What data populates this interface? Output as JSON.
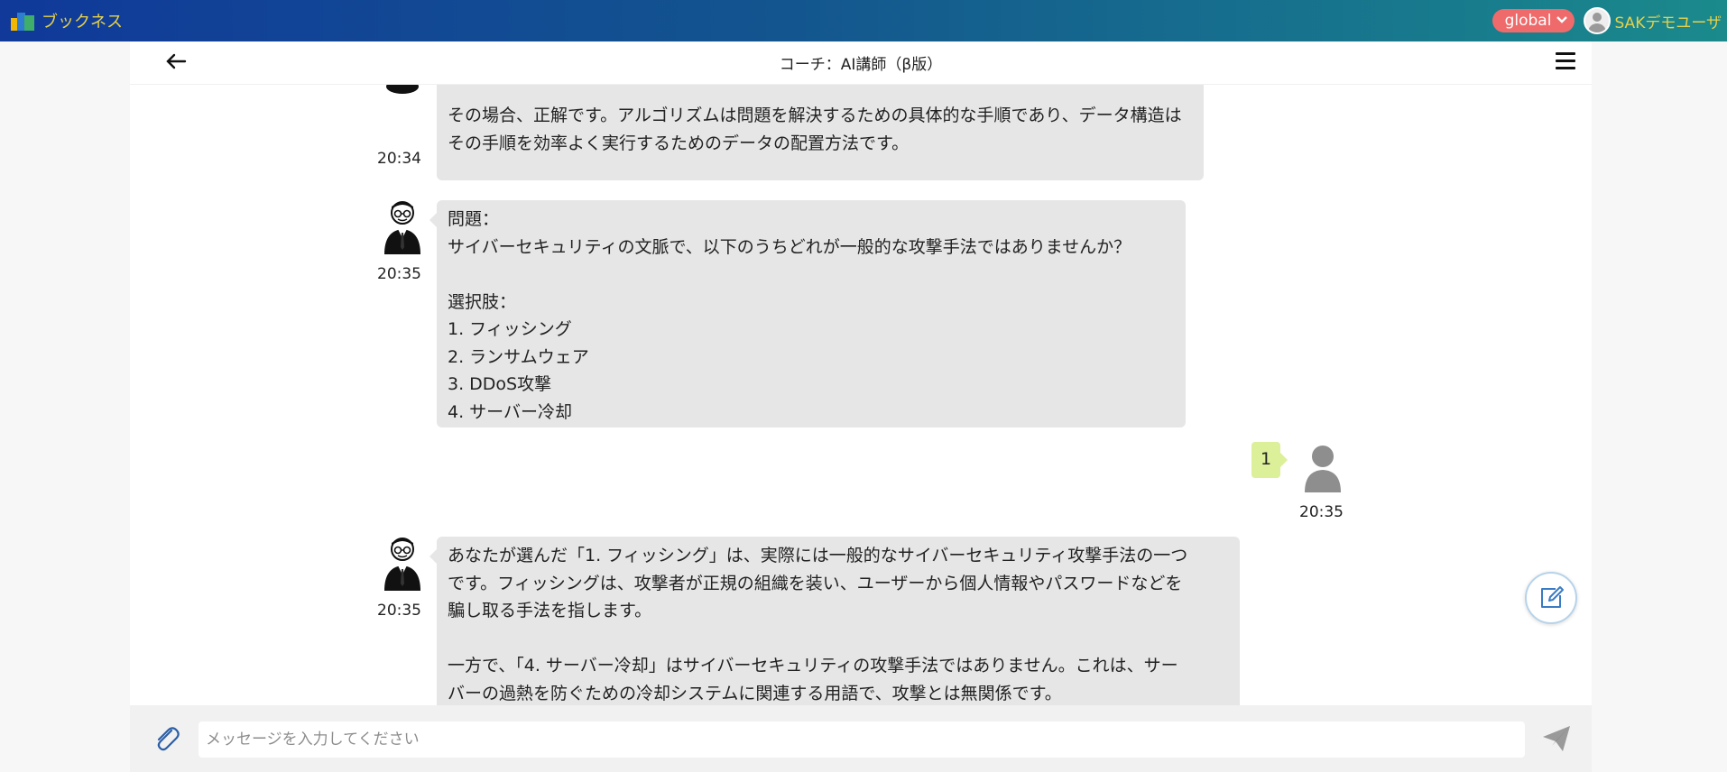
{
  "app": {
    "brand": "ブックネス",
    "region": "global",
    "user_name": "SAKデモユーザ"
  },
  "chat": {
    "title": "コーチ：AI講師（β版）",
    "messages": [
      {
        "sender": "bot",
        "time": "20:34",
        "text": "それまとんね。\n\nその場合、正解です。アルゴリズムは問題を解決するための具体的な手順であり、データ構造は\nその手順を効率よく実行するためのデータの配置方法です。"
      },
      {
        "sender": "bot",
        "time": "20:35",
        "text": "問題：\nサイバーセキュリティの文脈で、以下のうちどれが一般的な攻撃手法ではありませんか？\n\n選択肢：\n1. フィッシング\n2. ランサムウェア\n3. DDoS攻撃\n4. サーバー冷却"
      },
      {
        "sender": "user",
        "time": "20:35",
        "text": "1"
      },
      {
        "sender": "bot",
        "time": "20:35",
        "text": "あなたが選んだ「1. フィッシング」は、実際には一般的なサイバーセキュリティ攻撃手法の一つ\nです。フィッシングは、攻撃者が正規の組織を装い、ユーザーから個人情報やパスワードなどを\n騙し取る手法を指します。\n\n一方で、「4. サーバー冷却」はサイバーセキュリティの攻撃手法ではありません。これは、サー\nバーの過熱を防ぐための冷却システムに関連する用語で、攻撃とは無関係です。"
      }
    ]
  },
  "composer": {
    "placeholder": "メッセージを入力してください"
  },
  "colors": {
    "bot_bubble": "#e6e6e6",
    "user_bubble": "#dcef99",
    "region_pill": "#ef6b6b",
    "brand_text": "#e6d24a"
  },
  "icons": {
    "back": "arrow-left-icon",
    "menu": "hamburger-menu-icon",
    "attach": "paperclip-icon",
    "send": "paper-plane-icon",
    "edit": "edit-note-icon"
  }
}
